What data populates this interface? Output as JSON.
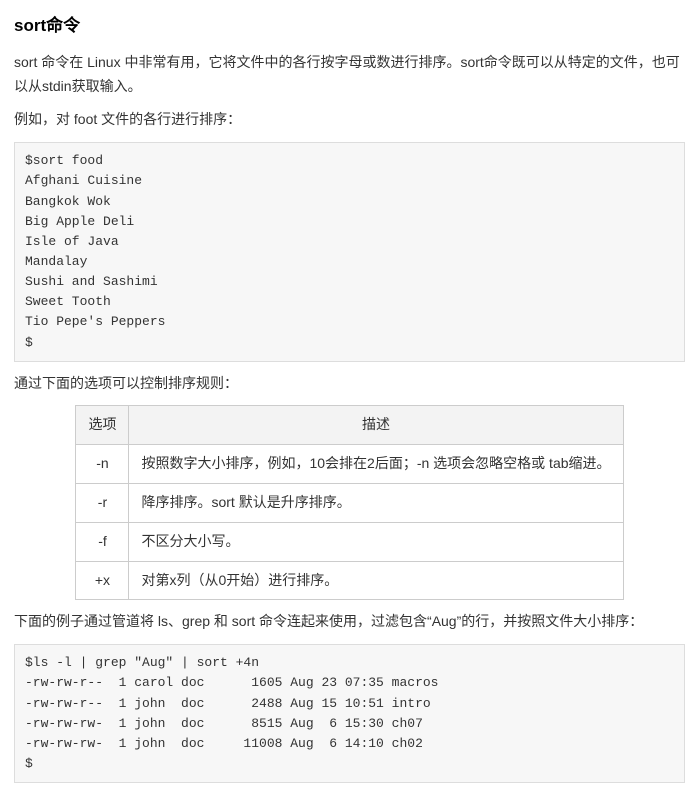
{
  "heading": "sort命令",
  "p1": "sort 命令在 Linux 中非常有用，它将文件中的各行按字母或数进行排序。sort命令既可以从特定的文件，也可以从stdin获取输入。",
  "p2": "例如，对 foot 文件的各行进行排序：",
  "code1": "$sort food\nAfghani Cuisine\nBangkok Wok\nBig Apple Deli\nIsle of Java\nMandalay\nSushi and Sashimi\nSweet Tooth\nTio Pepe's Peppers\n$",
  "p3": "通过下面的选项可以控制排序规则：",
  "table": {
    "head": [
      "选项",
      "描述"
    ],
    "rows": [
      {
        "opt": "-n",
        "desc": "按照数字大小排序，例如，10会排在2后面；-n 选项会忽略空格或 tab缩进。"
      },
      {
        "opt": "-r",
        "desc": "降序排序。sort 默认是升序排序。"
      },
      {
        "opt": "-f",
        "desc": "不区分大小写。"
      },
      {
        "opt": "+x",
        "desc": "对第x列（从0开始）进行排序。"
      }
    ]
  },
  "p4": "下面的例子通过管道将 ls、grep 和 sort 命令连起来使用，过滤包含“Aug”的行，并按照文件大小排序：",
  "code2": "$ls -l | grep \"Aug\" | sort +4n\n-rw-rw-r--  1 carol doc      1605 Aug 23 07:35 macros\n-rw-rw-r--  1 john  doc      2488 Aug 15 10:51 intro\n-rw-rw-rw-  1 john  doc      8515 Aug  6 15:30 ch07\n-rw-rw-rw-  1 john  doc     11008 Aug  6 14:10 ch02\n$"
}
